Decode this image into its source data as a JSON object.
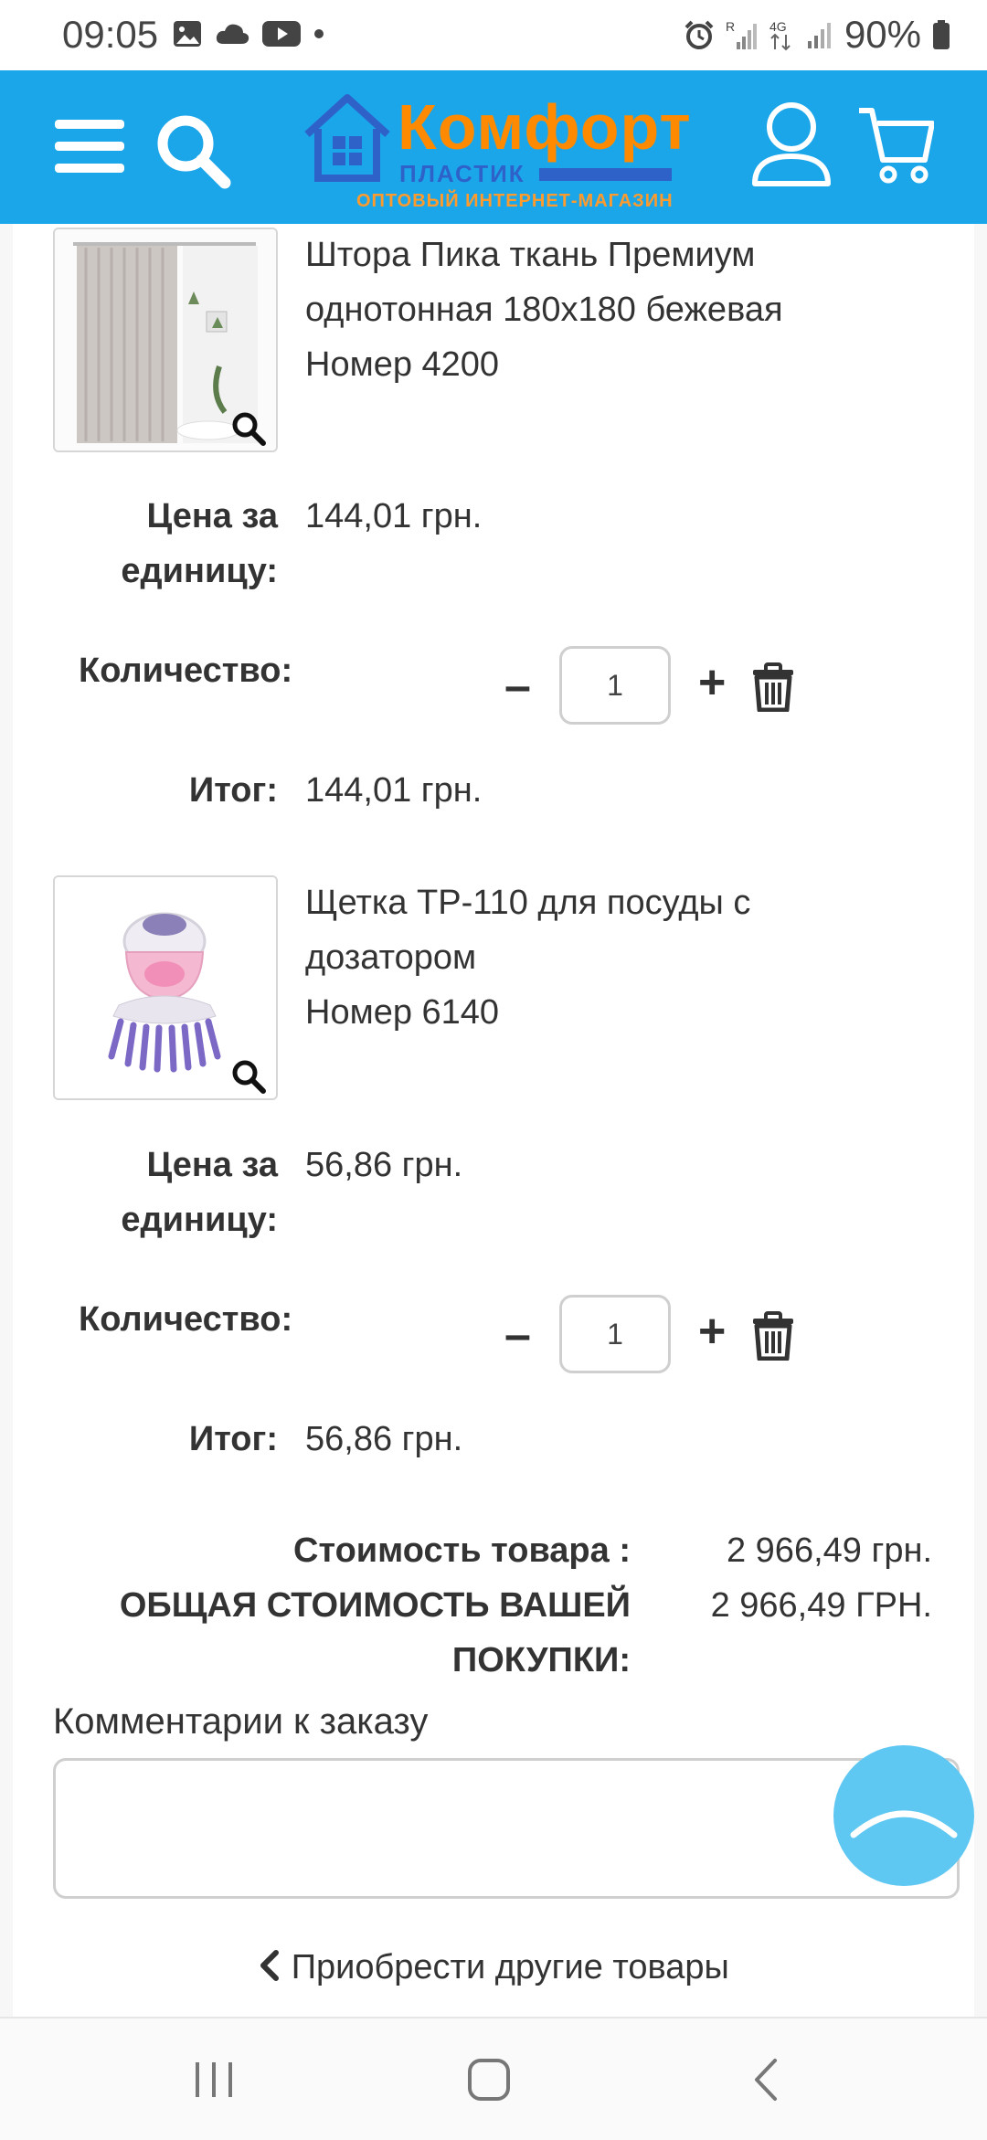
{
  "status_bar": {
    "time": "09:05",
    "battery": "90%",
    "left_icons": [
      "photo-icon",
      "cloud-icon",
      "youtube-icon",
      "dot-icon"
    ],
    "right_icons": [
      "alarm-icon",
      "signal-r-icon",
      "data-4g-icon",
      "signal-icon",
      "battery-icon"
    ]
  },
  "header": {
    "logo_title": "Комфорт",
    "logo_sub": "ПЛАСТИК",
    "logo_tagline": "ОПТОВЫЙ ИНТЕРНЕТ-МАГАЗИН",
    "icons": [
      "menu-icon",
      "search-icon",
      "user-icon",
      "cart-icon"
    ],
    "accent_color": "#1ba6ea",
    "logo_color": "#ff8a00"
  },
  "cart": {
    "labels": {
      "unit_price_line1": "Цена за",
      "unit_price_line2": "единицу:",
      "quantity": "Количество:",
      "total": "Итог:",
      "minus": "–",
      "plus": "+"
    },
    "items": [
      {
        "title_line1": "Штора Пика ткань Премиум",
        "title_line2": "однотонная 180х180 бежевая",
        "number": "Номер 4200",
        "unit_price": "144,01 грн.",
        "quantity": "1",
        "total": "144,01 грн."
      },
      {
        "title_line1": "Щетка ТР-110 для посуды с",
        "title_line2": "дозатором",
        "number": "Номер 6140",
        "unit_price": "56,86 грн.",
        "quantity": "1",
        "total": "56,86 грн."
      }
    ]
  },
  "summary": {
    "goods_cost_label": "Стоимость товара :",
    "goods_cost_value": "2 966,49 грн.",
    "grand_total_label_line1": "ОБЩАЯ СТОИМОСТЬ ВАШЕЙ",
    "grand_total_label_line2": "ПОКУПКИ:",
    "grand_total_value": "2 966,49 ГРН."
  },
  "comment": {
    "label": "Комментарии к заказу",
    "value": ""
  },
  "continue_shopping": "Приобрести другие товары",
  "nav_bar": [
    "recent-apps-icon",
    "home-icon",
    "back-icon"
  ]
}
